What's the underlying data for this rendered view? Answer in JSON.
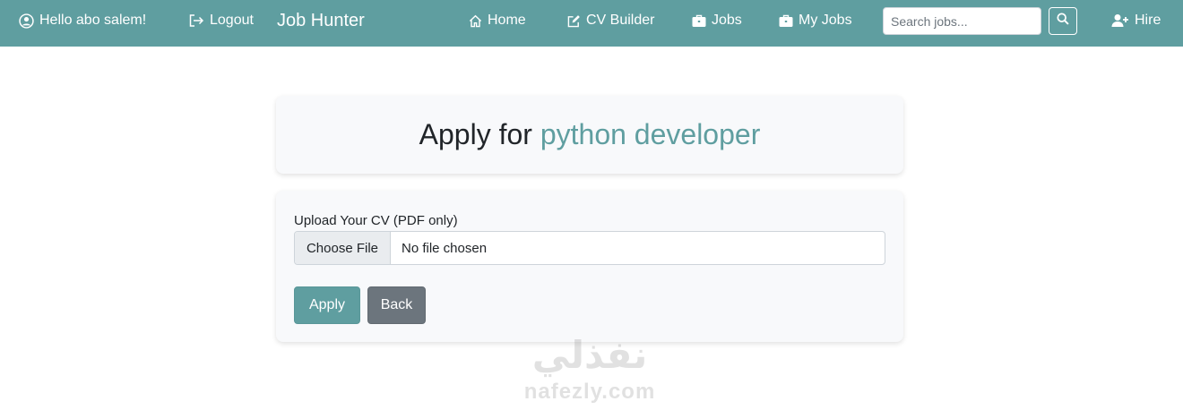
{
  "nav": {
    "greeting": "Hello abo salem!",
    "logout": "Logout",
    "brand": "Job Hunter",
    "home": "Home",
    "cv_builder": "CV Builder",
    "jobs": "Jobs",
    "my_jobs": "My Jobs",
    "search_placeholder": "Search jobs...",
    "hire": "Hire",
    "icons": [
      "user-circle-icon",
      "logout-icon",
      "home-icon",
      "edit-icon",
      "briefcase-icon",
      "briefcase-icon",
      "search-icon",
      "user-plus-icon"
    ]
  },
  "page": {
    "title_prefix": "Apply for",
    "job_title": "python developer"
  },
  "form": {
    "cv_label": "Upload Your CV (PDF only)",
    "choose_file": "Choose File",
    "file_status": "No file chosen",
    "apply_label": "Apply",
    "back_label": "Back"
  },
  "watermark": {
    "arabic": "نفذلي",
    "latin": "nafezly.com"
  },
  "colors": {
    "primary": "#5f9ea0",
    "secondary": "#6c757d",
    "card_bg": "#f8f9fb"
  }
}
